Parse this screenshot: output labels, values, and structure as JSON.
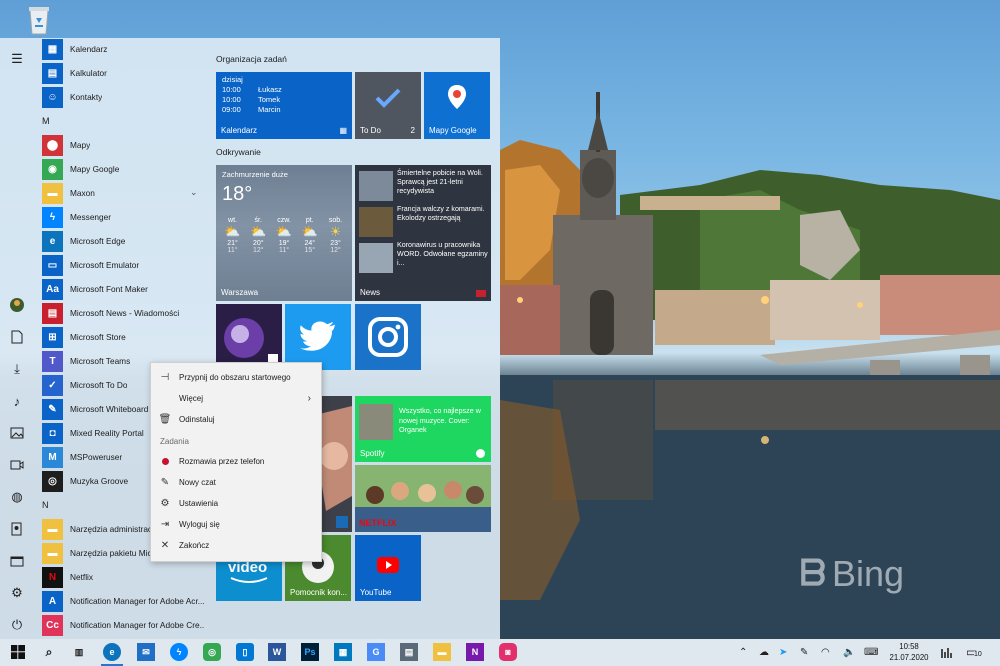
{
  "start_menu": {
    "apps": [
      {
        "label": "Kalendarz",
        "icon": "calendar-icon",
        "color": "#0a64c8"
      },
      {
        "label": "Kalkulator",
        "icon": "calculator-icon",
        "color": "#0a64c8"
      },
      {
        "label": "Kontakty",
        "icon": "contacts-icon",
        "color": "#0a64c8"
      },
      {
        "label": "Mapy",
        "icon": "maps-icon",
        "color": "#d13438"
      },
      {
        "label": "Mapy Google",
        "icon": "google-maps-icon",
        "color": "#34a853"
      },
      {
        "label": "Maxon",
        "icon": "folder-icon",
        "color": "#f0c040"
      },
      {
        "label": "Messenger",
        "icon": "messenger-icon",
        "color": "#0084ff"
      },
      {
        "label": "Microsoft Edge",
        "icon": "edge-icon",
        "color": "#0c74bd"
      },
      {
        "label": "Microsoft Emulator",
        "icon": "emulator-icon",
        "color": "#0a64c8"
      },
      {
        "label": "Microsoft Font Maker",
        "icon": "font-maker-icon",
        "color": "#0a64c8"
      },
      {
        "label": "Microsoft News - Wiadomości",
        "icon": "news-icon",
        "color": "#c8202e"
      },
      {
        "label": "Microsoft Store",
        "icon": "store-icon",
        "color": "#0a64c8"
      },
      {
        "label": "Microsoft Teams",
        "icon": "teams-icon",
        "color": "#5059c9"
      },
      {
        "label": "Microsoft To Do",
        "icon": "todo-icon",
        "color": "#2564cf"
      },
      {
        "label": "Microsoft Whiteboard",
        "icon": "whiteboard-icon",
        "color": "#0a64c8"
      },
      {
        "label": "Mixed Reality Portal",
        "icon": "mixed-reality-icon",
        "color": "#0a64c8"
      },
      {
        "label": "MSPoweruser",
        "icon": "mspoweruser-icon",
        "color": "#2b88d8"
      },
      {
        "label": "Muzyka Groove",
        "icon": "groove-icon",
        "color": "#1e1e1e"
      },
      {
        "label": "Narzędzia administracyjne",
        "icon": "folder-icon",
        "color": "#f0c040"
      },
      {
        "label": "Narzędzia pakietu Microsoft",
        "icon": "folder-icon",
        "color": "#f0c040"
      },
      {
        "label": "Netflix",
        "icon": "netflix-icon",
        "color": "#111111"
      },
      {
        "label": "Notification Manager for Adobe Acr...",
        "icon": "adobe-acrobat-icon",
        "color": "#0a64c8"
      },
      {
        "label": "Notification Manager for Adobe Cre...",
        "icon": "adobe-creative-icon",
        "color": "#e0335a"
      }
    ],
    "letters": {
      "m": "M",
      "n": "N"
    },
    "groups": {
      "tasks": "Organizacja zadań",
      "discover": "Odkrywanie"
    },
    "calendar_tile": {
      "day": "dzisiaj",
      "events": [
        {
          "time": "10:00",
          "name": "Łukasz"
        },
        {
          "time": "10:00",
          "name": "Tomek"
        },
        {
          "time": "09:00",
          "name": "Marcin"
        }
      ],
      "label": "Kalendarz"
    },
    "todo_tile": {
      "label": "To Do",
      "count": "2"
    },
    "maps_tile": {
      "label": "Mapy Google"
    },
    "weather_tile": {
      "condition": "Zachmurzenie duże",
      "temp": "18°",
      "days": [
        {
          "day": "wt.",
          "high": "21°",
          "low": "11°"
        },
        {
          "day": "śr.",
          "high": "20°",
          "low": "12°"
        },
        {
          "day": "czw.",
          "high": "19°",
          "low": "11°"
        },
        {
          "day": "pt.",
          "high": "24°",
          "low": "15°"
        },
        {
          "day": "sob.",
          "high": "23°",
          "low": "12°"
        }
      ],
      "city": "Warszawa"
    },
    "news_tile": {
      "items": [
        "Śmiertelne pobicie na Woli. Sprawcą jest 21-letni recydywista",
        "Francja walczy z komarami. Ekolodzy ostrzegają",
        "Koronawirus u pracownika WORD. Odwołane egzaminy i..."
      ],
      "label": "News"
    },
    "spotify_tile": {
      "text": "Wszystko, co najlepsze w nowej muzyce. Cover: Organek",
      "label": "Spotify"
    },
    "prime_tile": {
      "text": "video"
    },
    "assistant_tile": {
      "label": "Pomocnik kon..."
    },
    "youtube_tile": {
      "label": "YouTube"
    },
    "netflix_tile": {
      "text": "NETFLIX"
    }
  },
  "context_menu": {
    "pin": "Przypnij do obszaru startowego",
    "more": "Więcej",
    "uninstall": "Odinstaluj",
    "tasks_header": "Zadania",
    "call": "Rozmawia przez telefon",
    "new_chat": "Nowy czat",
    "settings": "Ustawienia",
    "sign_out": "Wyloguj się",
    "quit": "Zakończ"
  },
  "taskbar": {
    "time": "10:58",
    "date": "21.07.2020",
    "notifications_count": "10"
  },
  "wallpaper": {
    "brand": "Bing"
  }
}
